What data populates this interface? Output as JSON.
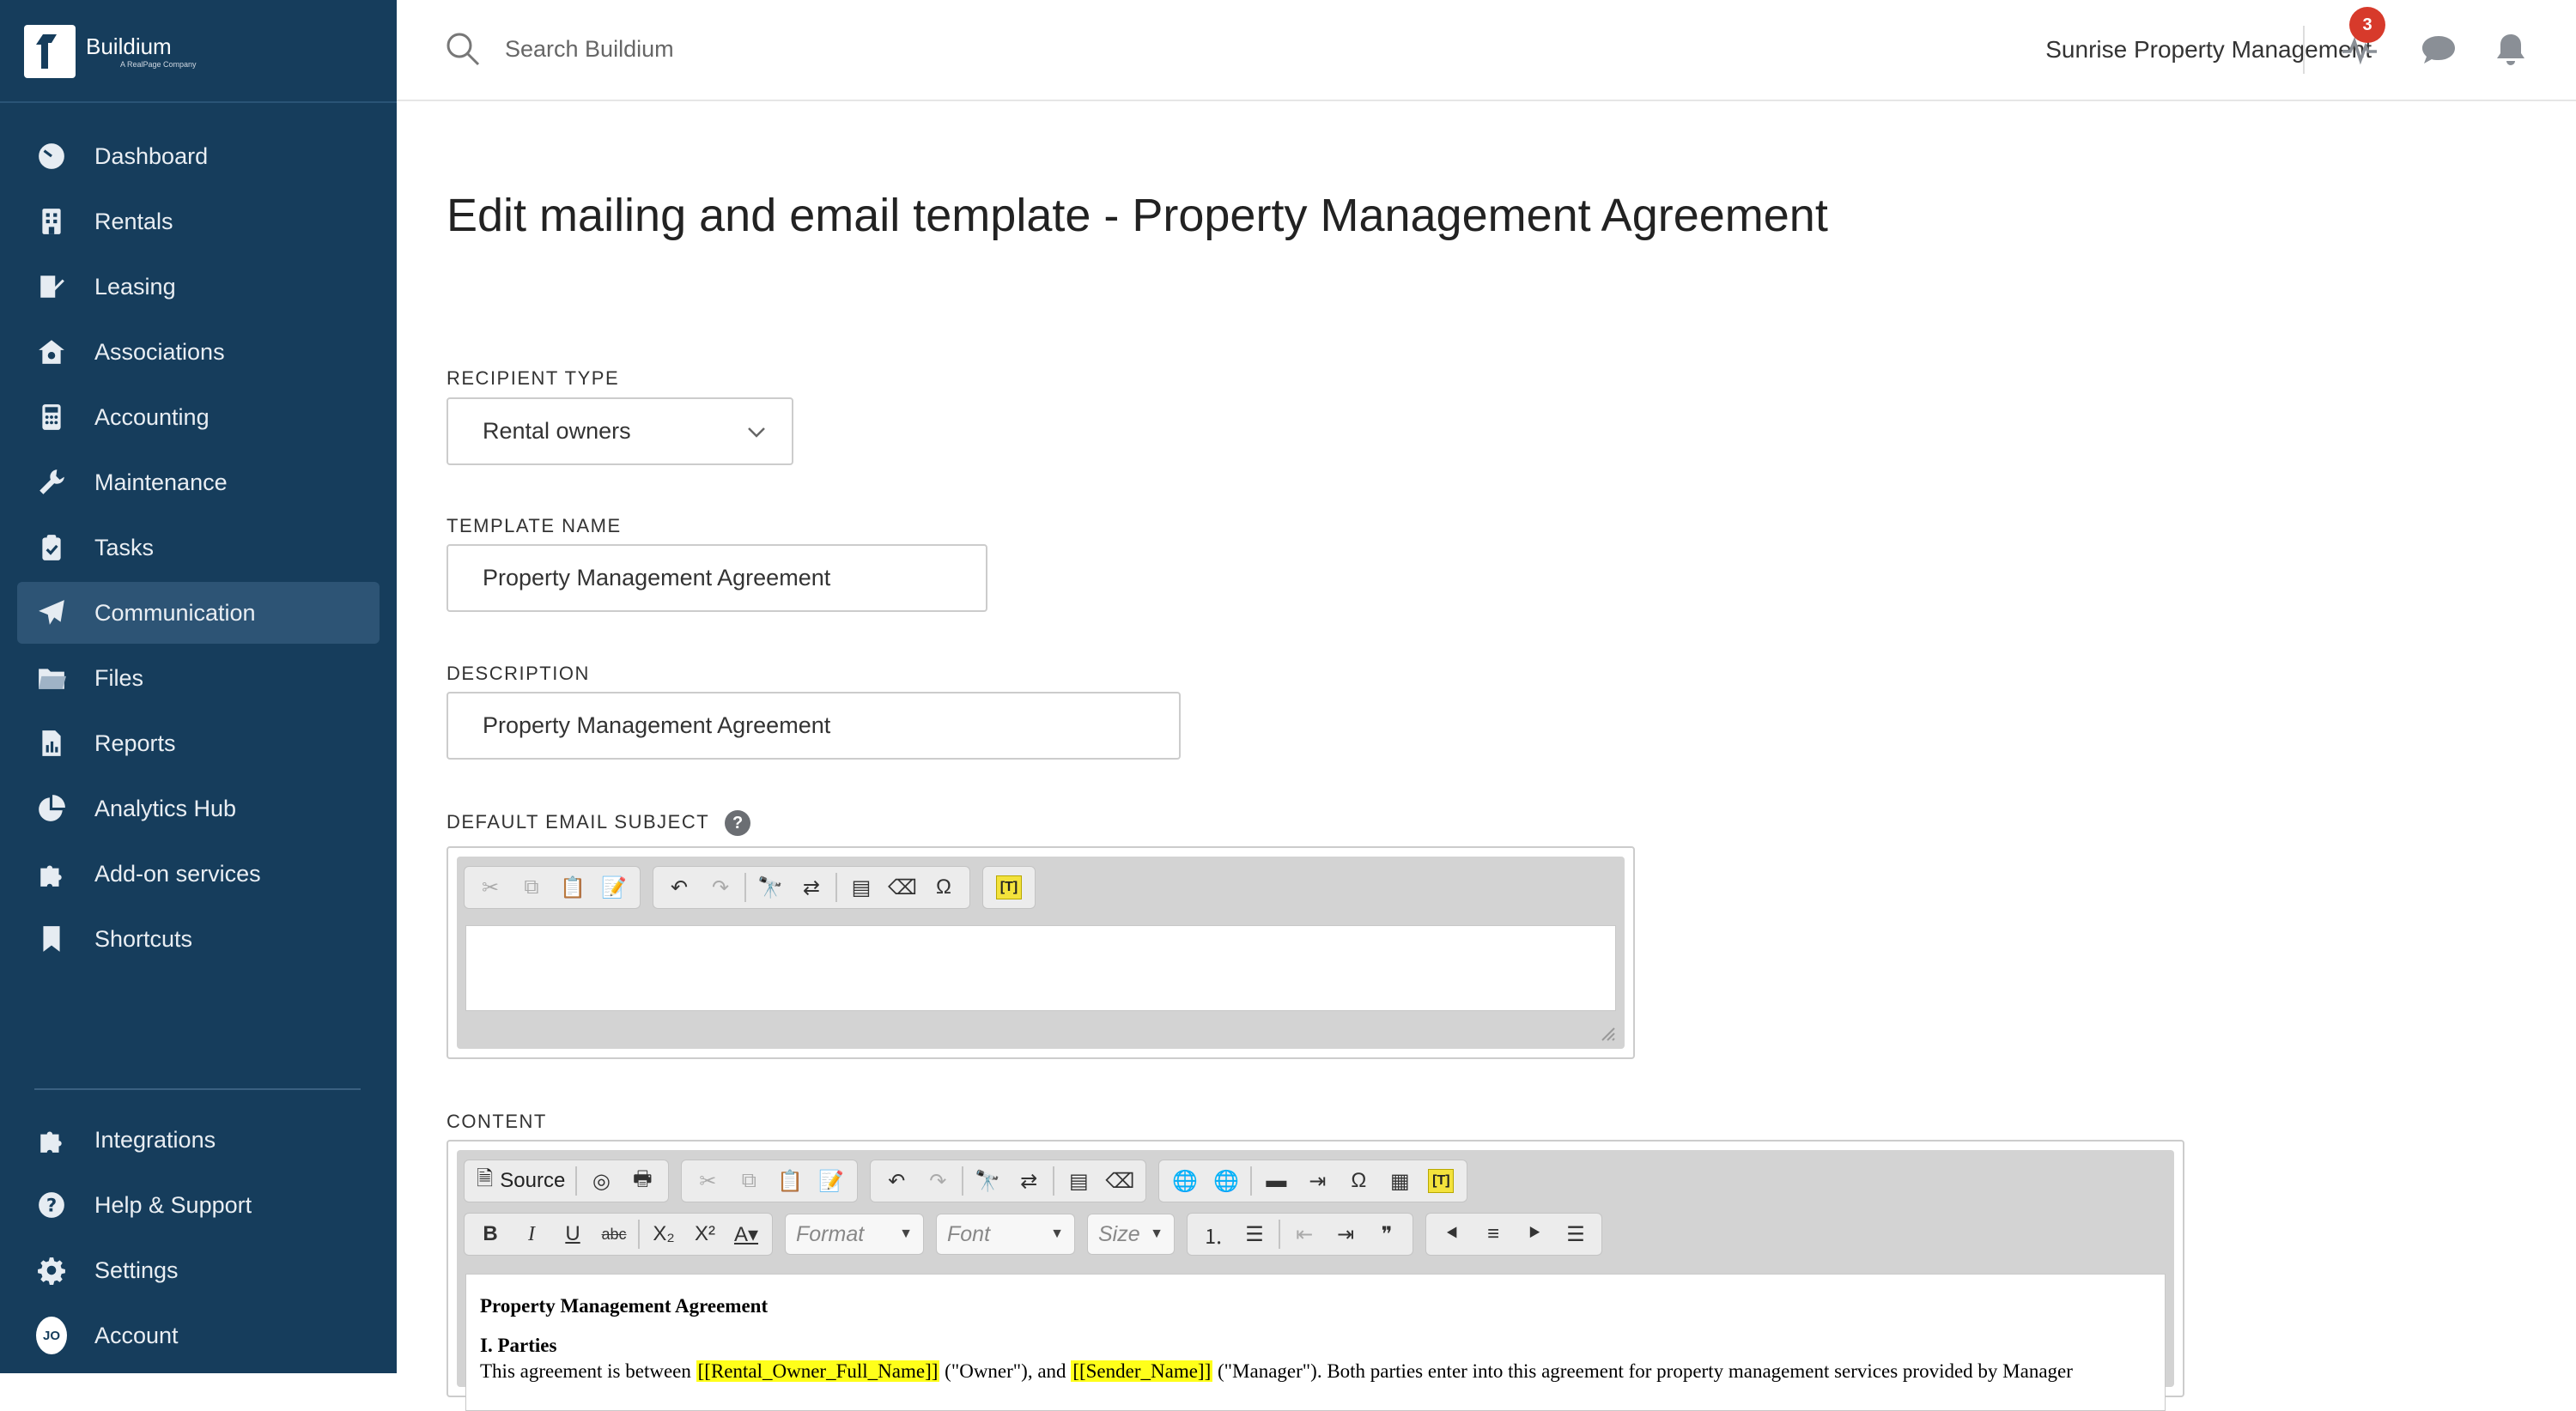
{
  "brand": {
    "name": "Buildium",
    "tagline": "A RealPage Company"
  },
  "sidebar": {
    "items": [
      {
        "label": "Dashboard",
        "icon": "dashboard-icon"
      },
      {
        "label": "Rentals",
        "icon": "building-icon"
      },
      {
        "label": "Leasing",
        "icon": "leasing-icon"
      },
      {
        "label": "Associations",
        "icon": "association-icon"
      },
      {
        "label": "Accounting",
        "icon": "calculator-icon"
      },
      {
        "label": "Maintenance",
        "icon": "wrench-icon"
      },
      {
        "label": "Tasks",
        "icon": "clipboard-icon"
      },
      {
        "label": "Communication",
        "icon": "paper-plane-icon",
        "active": true
      },
      {
        "label": "Files",
        "icon": "folder-icon"
      },
      {
        "label": "Reports",
        "icon": "report-icon"
      },
      {
        "label": "Analytics Hub",
        "icon": "pie-chart-icon"
      },
      {
        "label": "Add-on services",
        "icon": "puzzle-icon"
      },
      {
        "label": "Shortcuts",
        "icon": "bookmark-icon"
      }
    ],
    "bottom_items": [
      {
        "label": "Integrations",
        "icon": "puzzle-icon"
      },
      {
        "label": "Help & Support",
        "icon": "help-icon"
      },
      {
        "label": "Settings",
        "icon": "gear-icon"
      },
      {
        "label": "Account",
        "avatar": "JO"
      }
    ]
  },
  "topbar": {
    "search_placeholder": "Search Buildium",
    "org_name": "Sunrise Property Management",
    "activity_badge": "3"
  },
  "page": {
    "title": "Edit mailing and email template - Property Management Agreement",
    "recipient_type": {
      "label": "RECIPIENT TYPE",
      "value": "Rental owners"
    },
    "template_name": {
      "label": "TEMPLATE NAME",
      "value": "Property Management Agreement"
    },
    "description": {
      "label": "DESCRIPTION",
      "value": "Property Management Agreement"
    },
    "email_subject": {
      "label": "DEFAULT EMAIL SUBJECT",
      "help": "?"
    },
    "content": {
      "label": "CONTENT",
      "source_label": "Source",
      "format_placeholder": "Format",
      "font_placeholder": "Font",
      "size_placeholder": "Size",
      "doc": {
        "heading": "Property Management Agreement",
        "section1": "I. Parties",
        "line_pre": "This agreement is between ",
        "token_owner": "[[Rental_Owner_Full_Name]]",
        "line_mid": " (\"Owner\"), and ",
        "token_sender": "[[Sender_Name]]",
        "line_post": " (\"Manager\"). Both parties enter into this agreement for property management services provided by Manager"
      }
    }
  },
  "colors": {
    "sidebar_bg": "#163d5c",
    "active_bg": "#2d5475",
    "badge": "#d73a2b",
    "merge_field": "#ffff1a"
  }
}
